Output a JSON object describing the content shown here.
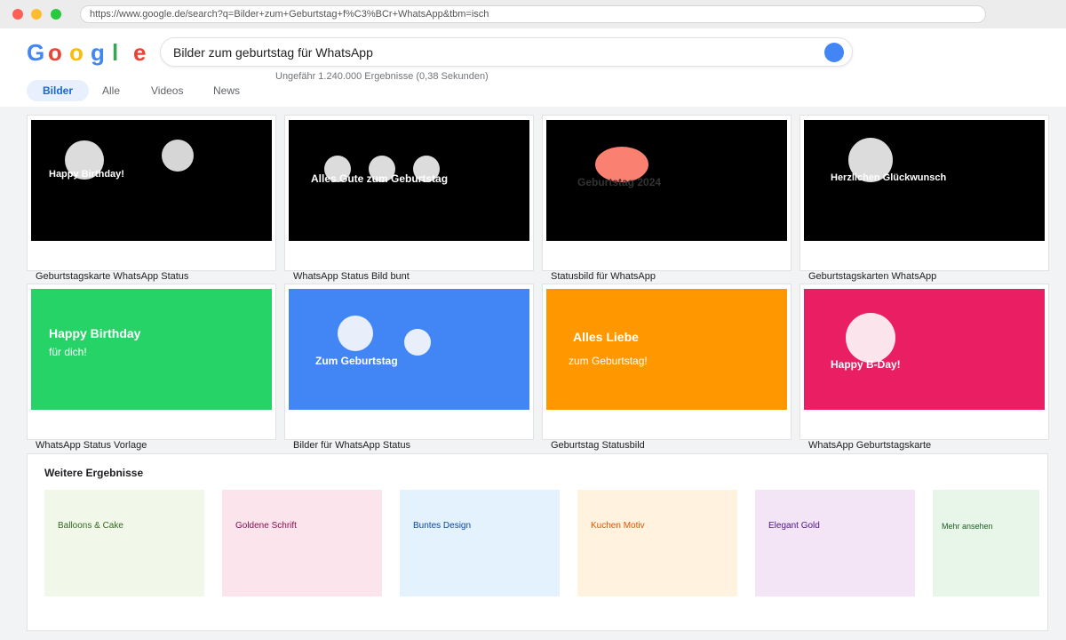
{
  "browser": {
    "url": "https://www.google.de/search?q=Bilder+zum+Geburtstag+f%C3%BCr+WhatsApp&tbm=isch"
  },
  "logo": {
    "letters": [
      "G",
      "o",
      "o",
      "g",
      "l",
      "e"
    ]
  },
  "search": {
    "query": "Bilder zum geburtstag für WhatsApp",
    "stats": "Ungefähr 1.240.000 Ergebnisse (0,38 Sekunden)"
  },
  "tabs": [
    {
      "label": "Bilder",
      "active": true
    },
    {
      "label": "Alle"
    },
    {
      "label": "Videos"
    },
    {
      "label": "News"
    }
  ],
  "results": [
    {
      "caption": "Geburtstagskarte WhatsApp Status",
      "text": "Happy Birthday!",
      "bg": "#000000"
    },
    {
      "caption": "WhatsApp Status Bild bunt",
      "text": "Alles Gute zum Geburtstag",
      "bg": "#000000"
    },
    {
      "caption": "Statusbild für WhatsApp",
      "text": "Geburtstag 2024",
      "bg": "#000000"
    },
    {
      "caption": "Geburtstagskarten WhatsApp",
      "text": "Herzlichen Glückwunsch",
      "bg": "#000000"
    },
    {
      "caption": "WhatsApp Status Vorlage",
      "text": "Happy Birthday",
      "sub": "für dich!",
      "bg": "#25d366"
    },
    {
      "caption": "Bilder für WhatsApp Status",
      "text": "Zum Geburtstag",
      "bg": "#4285f4"
    },
    {
      "caption": "Geburtstag Statusbild",
      "text": "Alles Liebe",
      "sub": "zum Geburtstag!",
      "bg": "#ff9800"
    },
    {
      "caption": "WhatsApp Geburtstagskarte",
      "text": "Happy B-Day!",
      "bg": "#e91e63"
    }
  ],
  "more_results": {
    "title": "Weitere Ergebnisse",
    "items": [
      {
        "label": "Balloons & Cake",
        "bg": "#f1f8e9",
        "color": "#33691e"
      },
      {
        "label": "Goldene Schrift",
        "bg": "#fce4ec",
        "color": "#880e4f"
      },
      {
        "label": "Buntes Design",
        "bg": "#e3f2fd",
        "color": "#0d47a1"
      },
      {
        "label": "Kuchen Motiv",
        "bg": "#fff3e0",
        "color": "#e65100"
      },
      {
        "label": "Elegant Gold",
        "bg": "#f3e5f5",
        "color": "#4a148c"
      },
      {
        "label": "Mehr ansehen",
        "bg": "#e8f5e9",
        "color": "#1b5e20"
      }
    ]
  }
}
